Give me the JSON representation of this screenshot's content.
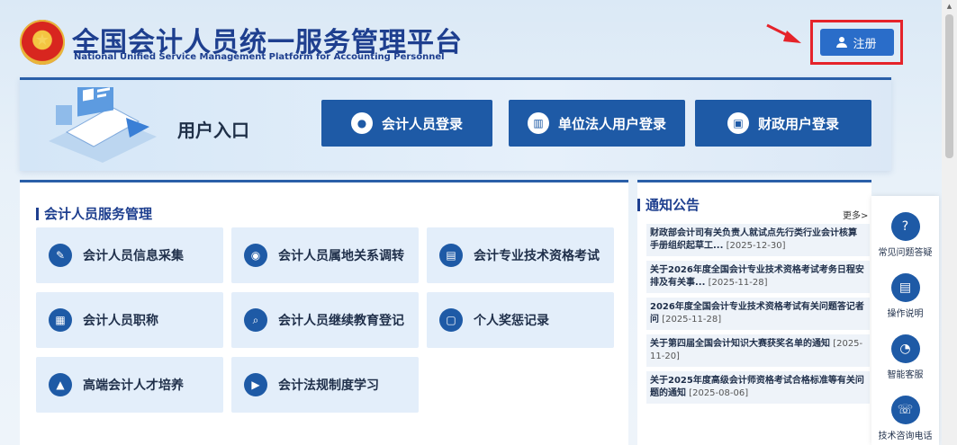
{
  "header": {
    "title_cn": "全国会计人员统一服务管理平台",
    "title_en": "National Unified Service Management Platform for Accounting Personnel",
    "register_label": "注册"
  },
  "login": {
    "entry_title": "用户入口",
    "buttons": [
      {
        "label": "会计人员登录",
        "icon": "user-icon"
      },
      {
        "label": "单位法人用户登录",
        "icon": "building-icon"
      },
      {
        "label": "财政用户登录",
        "icon": "id-card-icon"
      }
    ]
  },
  "services": {
    "title": "会计人员服务管理",
    "items": [
      {
        "label": "会计人员信息采集",
        "icon": "edit-icon"
      },
      {
        "label": "会计人员属地关系调转",
        "icon": "location-icon"
      },
      {
        "label": "会计专业技术资格考试",
        "icon": "document-icon"
      },
      {
        "label": "会计人员职称",
        "icon": "certificate-icon"
      },
      {
        "label": "会计人员继续教育登记",
        "icon": "search-doc-icon"
      },
      {
        "label": "个人奖惩记录",
        "icon": "clipboard-icon"
      },
      {
        "label": "高端会计人才培养",
        "icon": "graduation-icon"
      },
      {
        "label": "会计法规制度学习",
        "icon": "play-icon"
      }
    ]
  },
  "notices": {
    "title": "通知公告",
    "more": "更多>",
    "items": [
      {
        "text": "财政部会计司有关负责人就试点先行类行业会计核算手册组织起草工...",
        "date": "[2025-12-30]"
      },
      {
        "text": "关于2026年度全国会计专业技术资格考试考务日程安排及有关事...",
        "date": "[2025-11-28]"
      },
      {
        "text": "2026年度全国会计专业技术资格考试有关问题答记者问",
        "date": "[2025-11-28]"
      },
      {
        "text": "关于第四届全国会计知识大赛获奖名单的通知",
        "date": "[2025-11-20]"
      },
      {
        "text": "关于2025年度高级会计师资格考试合格标准等有关问题的通知",
        "date": "[2025-08-06]"
      }
    ]
  },
  "float_bar": {
    "items": [
      {
        "label": "常见问题答疑",
        "icon": "question-icon"
      },
      {
        "label": "操作说明",
        "icon": "manual-icon"
      },
      {
        "label": "智能客服",
        "icon": "chat-icon"
      },
      {
        "label": "技术咨询电话",
        "icon": "phone-icon"
      }
    ]
  },
  "colors": {
    "primary": "#1e5aa6",
    "title": "#1e3f8f",
    "highlight": "#e5232a"
  }
}
